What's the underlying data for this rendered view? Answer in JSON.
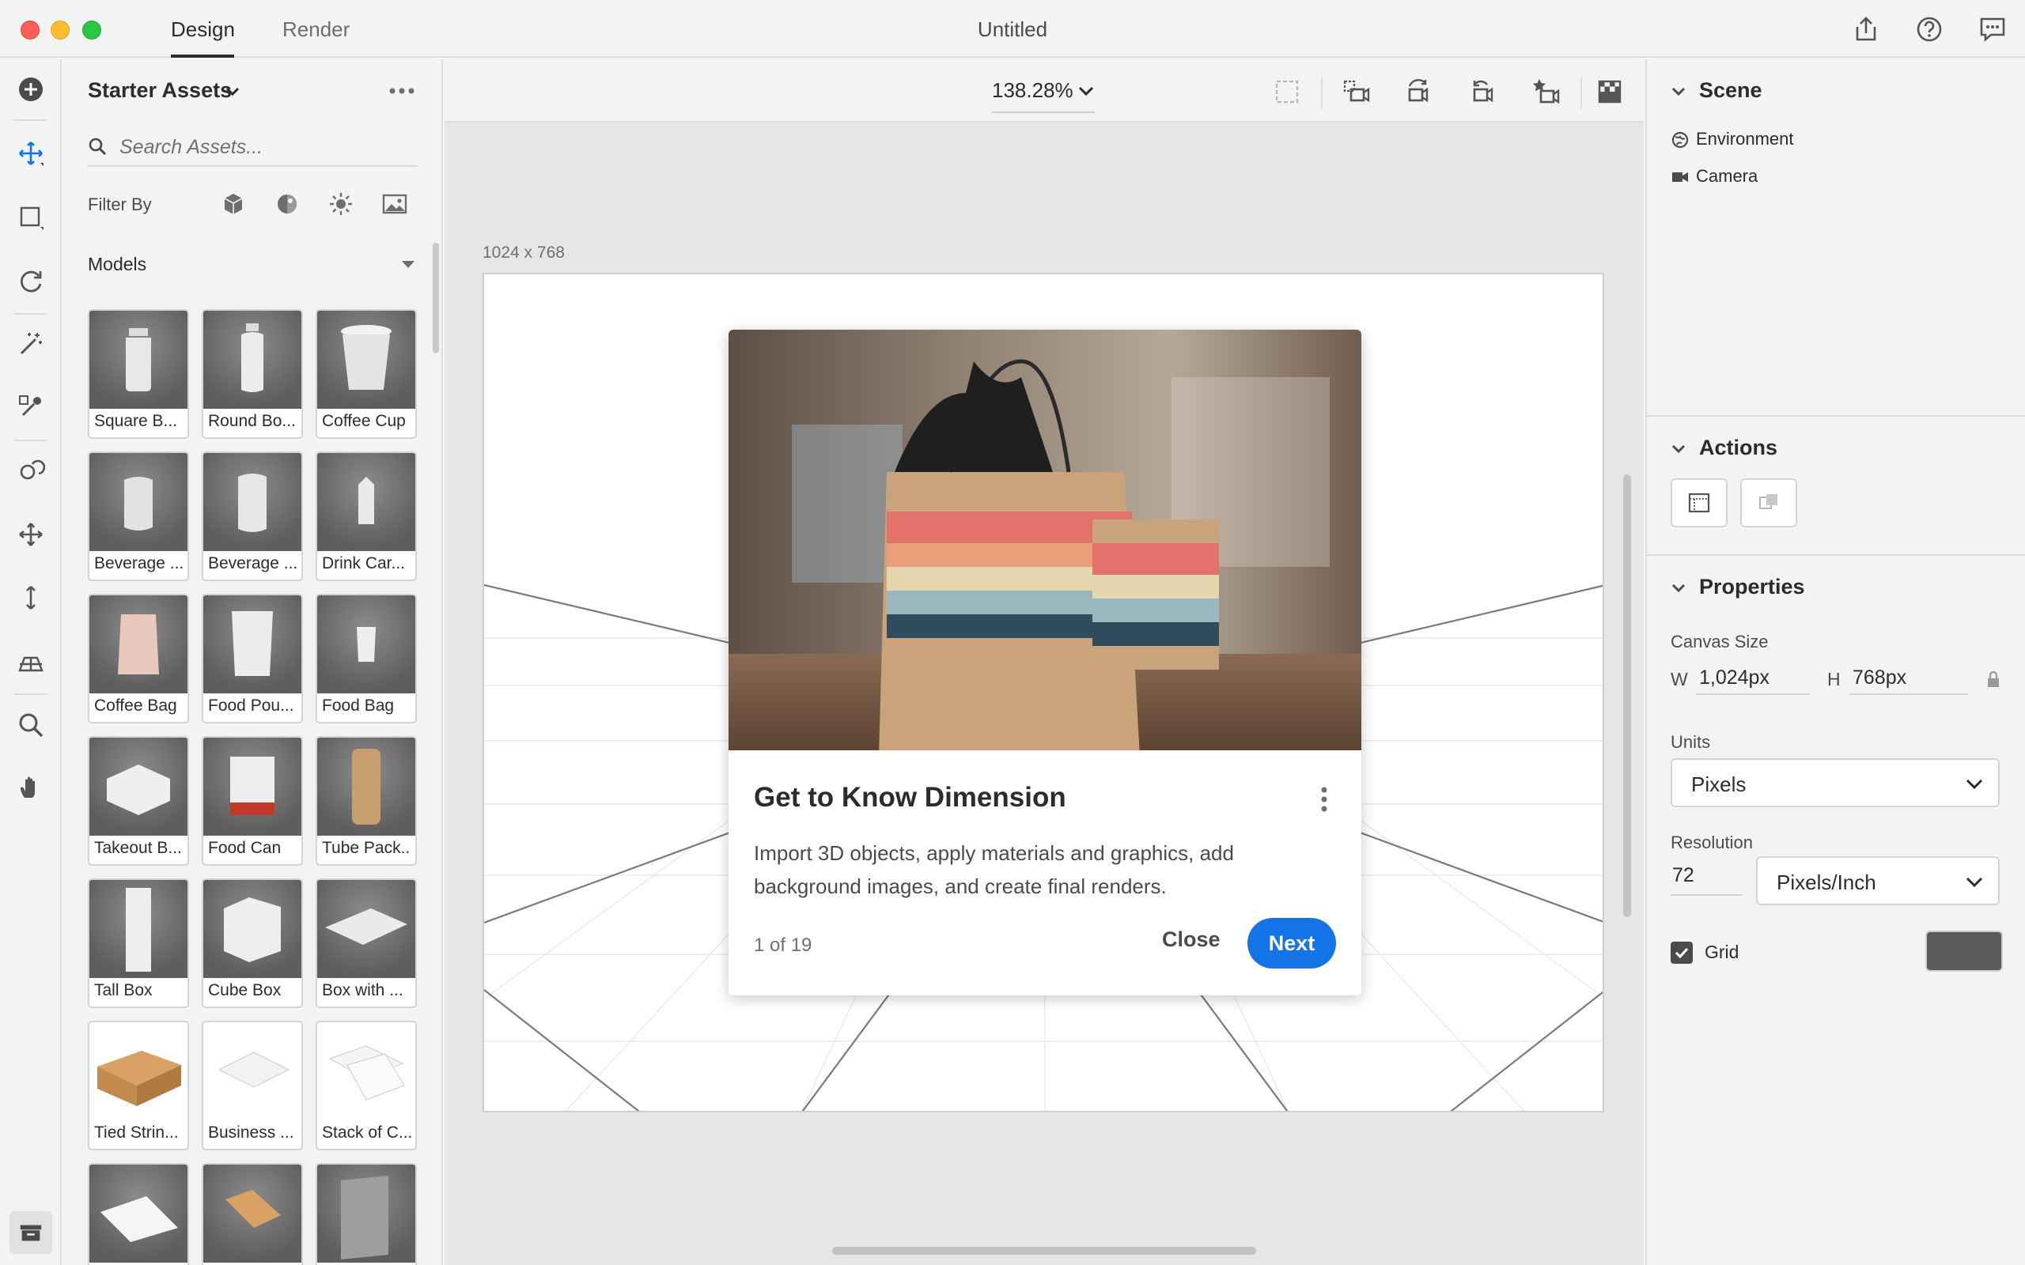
{
  "titlebar": {
    "tabs": [
      {
        "label": "Design",
        "active": true
      },
      {
        "label": "Render",
        "active": false
      }
    ],
    "document_title": "Untitled",
    "icons": [
      "share-icon",
      "help-icon",
      "feedback-icon"
    ]
  },
  "tool_rail": {
    "tools": [
      "add-icon",
      "move-icon",
      "select-icon",
      "orbit-icon",
      "magic-wand-icon",
      "eyedropper-icon",
      "sample-icon",
      "pan-icon",
      "dolly-icon",
      "horizon-icon",
      "zoom-icon",
      "hand-icon"
    ],
    "bottom": "library-icon"
  },
  "assets": {
    "title": "Starter Assets",
    "search_placeholder": "Search Assets...",
    "filter_label": "Filter By",
    "filter_icons": [
      "models-icon",
      "materials-icon",
      "lights-icon",
      "images-icon"
    ],
    "section_label": "Models",
    "items": [
      {
        "label": "Square B..."
      },
      {
        "label": "Round Bo..."
      },
      {
        "label": "Coffee Cup"
      },
      {
        "label": "Beverage ..."
      },
      {
        "label": "Beverage ..."
      },
      {
        "label": "Drink Car..."
      },
      {
        "label": "Coffee Bag"
      },
      {
        "label": "Food Pou..."
      },
      {
        "label": "Food Bag"
      },
      {
        "label": "Takeout B..."
      },
      {
        "label": "Food Can"
      },
      {
        "label": "Tube Pack.."
      },
      {
        "label": "Tall Box"
      },
      {
        "label": "Cube Box"
      },
      {
        "label": "Box with ..."
      },
      {
        "label": "Tied Strin..."
      },
      {
        "label": "Business ..."
      },
      {
        "label": "Stack of C..."
      },
      {
        "label": ""
      },
      {
        "label": ""
      },
      {
        "label": ""
      }
    ]
  },
  "canvas": {
    "zoom": "138.28%",
    "dimensions": "1024 x 768"
  },
  "onboarding": {
    "title": "Get to Know Dimension",
    "body": "Import 3D objects, apply materials and graphics, add background images, and create final renders.",
    "page_indicator": "1 of 19",
    "close_label": "Close",
    "next_label": "Next"
  },
  "right_panel": {
    "scene": {
      "heading": "Scene",
      "items": [
        "Environment",
        "Camera"
      ]
    },
    "actions": {
      "heading": "Actions"
    },
    "properties": {
      "heading": "Properties",
      "canvas_size_label": "Canvas Size",
      "width_label": "W",
      "width_value": "1,024px",
      "height_label": "H",
      "height_value": "768px",
      "units_label": "Units",
      "units_value": "Pixels",
      "resolution_label": "Resolution",
      "resolution_value": "72",
      "resolution_unit": "Pixels/Inch",
      "grid_label": "Grid",
      "grid_checked": true,
      "grid_color": "#5a5a5a"
    }
  },
  "colors": {
    "accent": "#1473e6",
    "tool_active": "#1473e6"
  }
}
